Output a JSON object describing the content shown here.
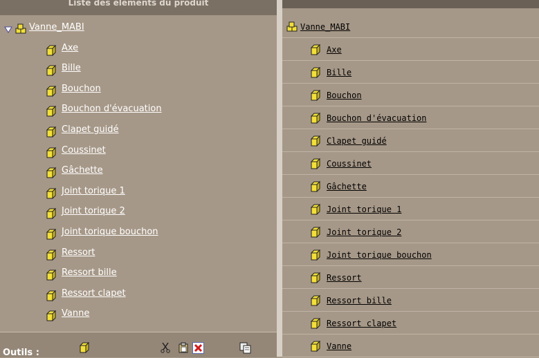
{
  "left_panel": {
    "header": "Liste des elements du produit",
    "root": "Vanne_MABI",
    "items": [
      "Axe",
      "Bille",
      "Bouchon",
      "Bouchon d'évacuation",
      "Clapet guidé",
      "Coussinet",
      "Gâchette",
      "Joint torique 1",
      "Joint torique 2",
      "Joint torique bouchon",
      "Ressort",
      "Ressort bille",
      "Ressort clapet",
      "Vanne"
    ]
  },
  "toolbar": {
    "label": "Outils :"
  },
  "right_panel": {
    "root": "Vanne_MABI",
    "items": [
      "Axe",
      "Bille",
      "Bouchon",
      "Bouchon d'évacuation",
      "Clapet guidé",
      "Coussinet",
      "Gâchette",
      "Joint torique 1",
      "Joint torique 2",
      "Joint torique bouchon",
      "Ressort",
      "Ressort bille",
      "Ressort clapet",
      "Vanne"
    ]
  },
  "colors": {
    "background": "#a69888",
    "header": "#7b7064",
    "divider": "#d8d0c6",
    "part_icon": "#f2df3a",
    "link_left": "#ffffff",
    "link_right": "#000000"
  },
  "icons": {
    "expand": "triangle-down-icon",
    "assembly": "assembly-icon",
    "part": "part-cube-icon",
    "cut": "scissors-icon",
    "paste": "clipboard-icon",
    "delete": "delete-icon",
    "copy": "copy-icon"
  }
}
